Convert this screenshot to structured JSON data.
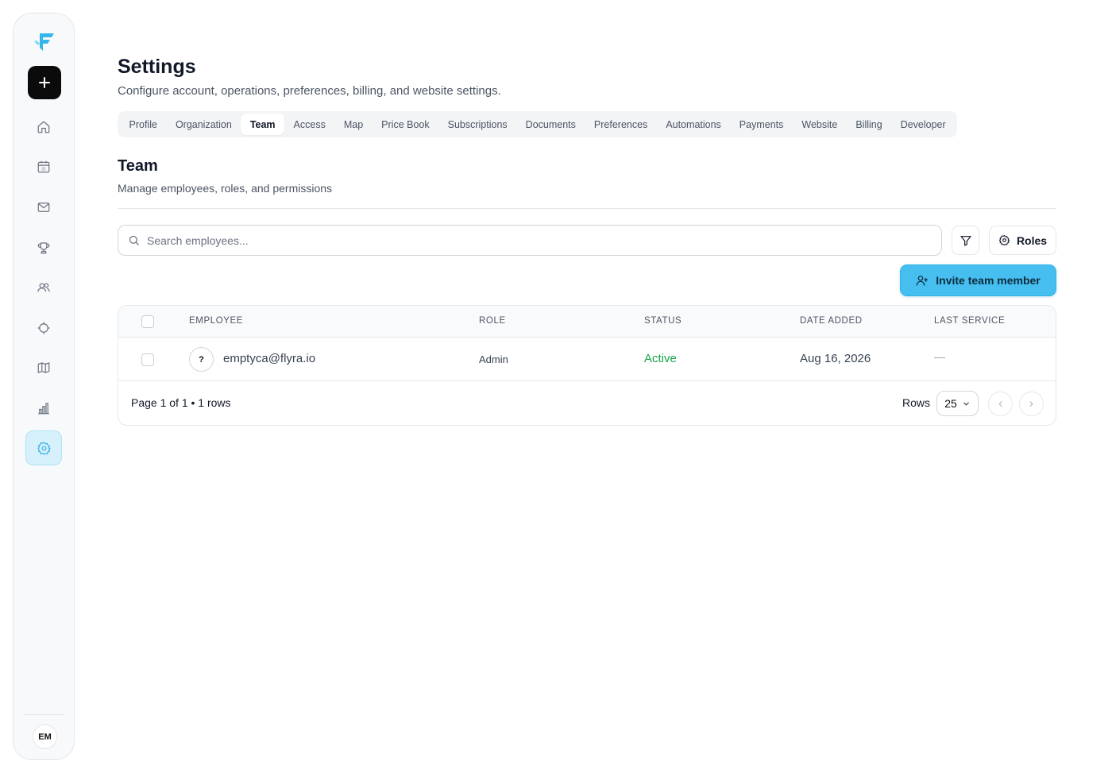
{
  "sidebar": {
    "new_button_label": "+",
    "nav_items": [
      {
        "name": "home-icon"
      },
      {
        "name": "calendar-icon"
      },
      {
        "name": "mail-icon"
      },
      {
        "name": "trophy-icon"
      },
      {
        "name": "users-icon"
      },
      {
        "name": "target-icon"
      },
      {
        "name": "map-icon"
      },
      {
        "name": "bar-chart-icon"
      },
      {
        "name": "settings-icon",
        "active": true
      }
    ],
    "user_initials": "EM",
    "accent_color": "#46bff0"
  },
  "header": {
    "title": "Settings",
    "subtitle": "Configure account, operations, preferences, billing, and website settings."
  },
  "tabs": [
    {
      "label": "Profile"
    },
    {
      "label": "Organization"
    },
    {
      "label": "Team",
      "active": true
    },
    {
      "label": "Access"
    },
    {
      "label": "Map"
    },
    {
      "label": "Price Book"
    },
    {
      "label": "Subscriptions"
    },
    {
      "label": "Documents"
    },
    {
      "label": "Preferences"
    },
    {
      "label": "Automations"
    },
    {
      "label": "Payments"
    },
    {
      "label": "Website"
    },
    {
      "label": "Billing"
    },
    {
      "label": "Developer"
    }
  ],
  "section": {
    "title": "Team",
    "subtitle": "Manage employees, roles, and permissions"
  },
  "toolbar": {
    "search_placeholder": "Search employees...",
    "search_value": "",
    "roles_label": "Roles",
    "invite_label": "Invite team member"
  },
  "table": {
    "columns": [
      "Employee",
      "Role",
      "Status",
      "Date Added",
      "Last Service"
    ],
    "rows": [
      {
        "avatar": "?",
        "employee": "emptyca@flyra.io",
        "role": "Admin",
        "status": "Active",
        "date_added": "Aug 16, 2026",
        "last_service": "—"
      }
    ],
    "footer": {
      "page_info": "Page 1 of 1 • 1 rows",
      "rows_label": "Rows",
      "rows_per_page": "25"
    }
  }
}
